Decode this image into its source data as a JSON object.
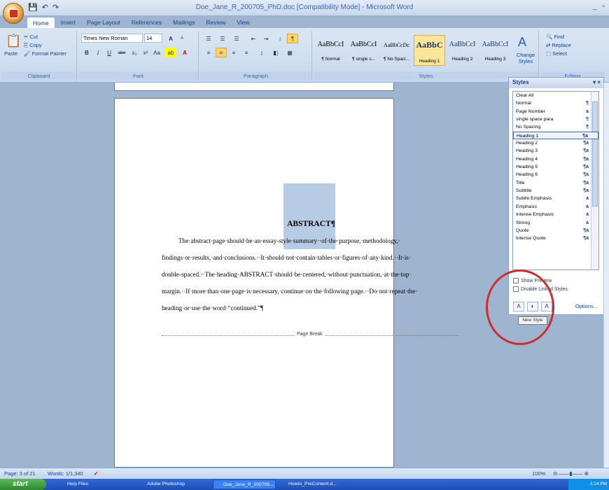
{
  "window": {
    "title": "Doe_Jane_R_200705_PhD.doc [Compatibility Mode] - Microsoft Word",
    "minimize": "_",
    "restore": "▫"
  },
  "qat": {
    "save": "💾",
    "undo": "↶",
    "redo": "↷"
  },
  "tabs": [
    "Home",
    "Insert",
    "Page Layout",
    "References",
    "Mailings",
    "Review",
    "View"
  ],
  "clipboard": {
    "paste": "Paste",
    "cut": "Cut",
    "copy": "Copy",
    "format_painter": "Format Painter",
    "label": "Clipboard"
  },
  "font": {
    "name": "Times New Roman",
    "size": "14",
    "label": "Font",
    "bold": "B",
    "italic": "I",
    "underline": "U",
    "strike": "abe",
    "sub": "x₂",
    "sup": "x²",
    "case": "Aa",
    "grow": "A",
    "shrink": "A"
  },
  "paragraph": {
    "label": "Paragraph"
  },
  "styles_gallery": {
    "label": "Styles",
    "items": [
      {
        "preview": "AaBbCcI",
        "name": "¶ Normal"
      },
      {
        "preview": "AaBbCcI",
        "name": "¶ single s..."
      },
      {
        "preview": "AaBbCcDc",
        "name": "¶ No Spaci..."
      },
      {
        "preview": "AaBbC",
        "name": "Heading 1"
      },
      {
        "preview": "AaBbCcI",
        "name": "Heading 2"
      },
      {
        "preview": "AaBbCcI",
        "name": "Heading 3"
      }
    ],
    "change_styles": "Change Styles"
  },
  "editing": {
    "find": "Find",
    "replace": "Replace",
    "select": "Select",
    "label": "Editing"
  },
  "document": {
    "heading": "ABSTRACT¶",
    "lines": [
      "The·abstract·page·should·be·an·essay-style·summary··of·the·purpose,·methodology,·",
      "findings·or·results,·and·conclusions.··It·should·not·contain·tables·or·figures·of·any·kind.··It·is·",
      "double-spaced.··The·heading·ABSTRACT·should·be·centered,·without·punctuation,·at·the·top·",
      "margin.··If·more·than·one·page·is·necessary,·continue·on·the·following·page.··Do·not·repeat·the·",
      "heading·or·use·the·word·“continued.”¶"
    ],
    "page_break": "Page Break"
  },
  "styles_pane": {
    "title": "Styles",
    "close": "▾ ×",
    "items": [
      {
        "name": "Clear All",
        "mark": ""
      },
      {
        "name": "Normal",
        "mark": "¶"
      },
      {
        "name": "Page Number",
        "mark": "a"
      },
      {
        "name": "single space para",
        "mark": "¶"
      },
      {
        "name": "No Spacing",
        "mark": "¶"
      },
      {
        "name": "Heading 1",
        "mark": "¶a"
      },
      {
        "name": "Heading 2",
        "mark": "¶a"
      },
      {
        "name": "Heading 3",
        "mark": "¶a"
      },
      {
        "name": "Heading 4",
        "mark": "¶a"
      },
      {
        "name": "Heading 5",
        "mark": "¶a"
      },
      {
        "name": "Heading 6",
        "mark": "¶a"
      },
      {
        "name": "Title",
        "mark": "¶a"
      },
      {
        "name": "Subtitle",
        "mark": "¶a"
      },
      {
        "name": "Subtle Emphasis",
        "mark": "a"
      },
      {
        "name": "Emphasis",
        "mark": "a"
      },
      {
        "name": "Intense Emphasis",
        "mark": "a"
      },
      {
        "name": "Strong",
        "mark": "a"
      },
      {
        "name": "Quote",
        "mark": "¶a"
      },
      {
        "name": "Intense Quote",
        "mark": "¶a"
      }
    ],
    "selected": "Heading 1",
    "show_preview": "Show Preview",
    "disable_linked": "Disable Linked Styles",
    "options": "Options...",
    "tooltip": "New Style"
  },
  "status": {
    "page": "Page: 3 of 21",
    "words": "Words: 1/1,340",
    "zoom": "100%"
  },
  "taskbar": {
    "start": "start",
    "items": [
      "Help Files",
      "Adobe Photoshop",
      "Doe_Jane_R_200705...",
      "Howto_PreContent.d..."
    ],
    "clock": "3:14 PM"
  }
}
